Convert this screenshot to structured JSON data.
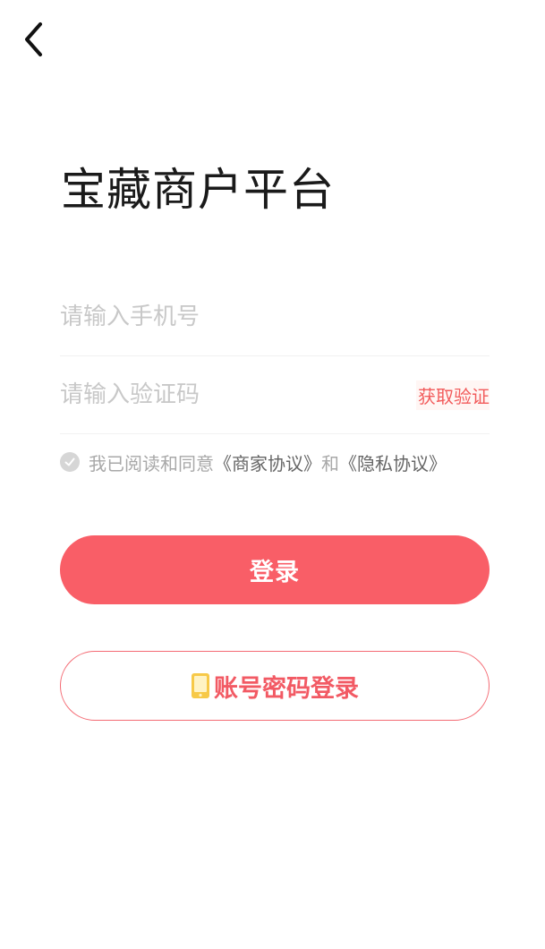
{
  "header": {
    "back_icon": "chevron-left-icon"
  },
  "title": "宝藏商户平台",
  "form": {
    "phone_placeholder": "请输入手机号",
    "code_placeholder": "请输入验证码",
    "get_code_label": "获取验证"
  },
  "agreement": {
    "checked": false,
    "prefix": "我已阅读和同意",
    "merchant_link": "《商家协议》",
    "conjunction": "和",
    "privacy_link": "《隐私协议》"
  },
  "actions": {
    "login_label": "登录",
    "password_login_label": "账号密码登录",
    "password_login_icon": "phone-icon"
  },
  "colors": {
    "accent": "#f95e67",
    "link_red": "#f25c5c",
    "phone_icon": "#f7c948"
  }
}
